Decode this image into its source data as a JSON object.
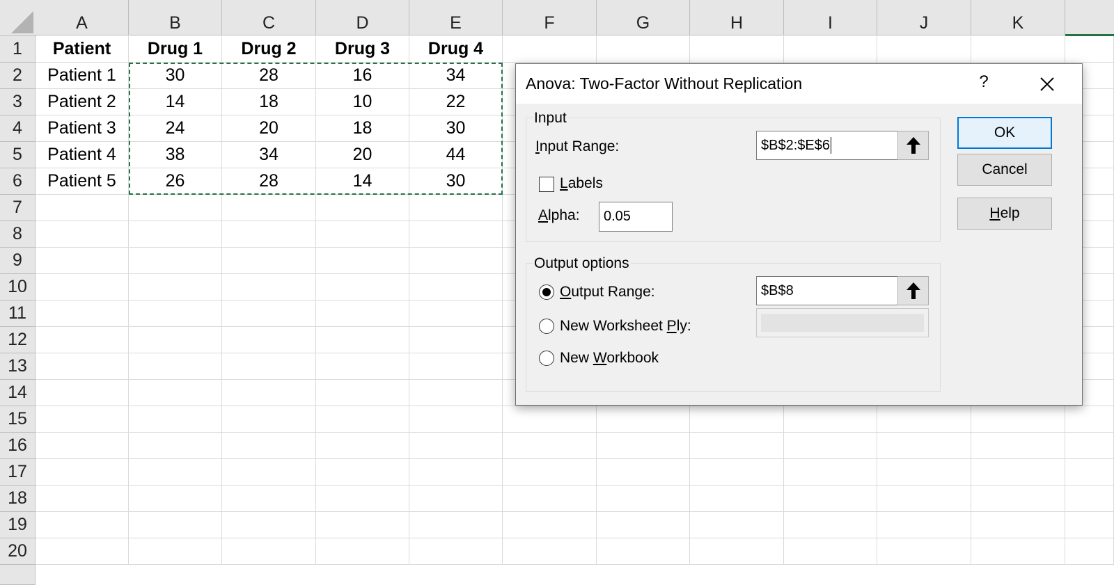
{
  "sheet": {
    "columns": [
      "A",
      "B",
      "C",
      "D",
      "E",
      "F",
      "G",
      "H",
      "I",
      "J",
      "K"
    ],
    "rows": [
      "1",
      "2",
      "3",
      "4",
      "5",
      "6",
      "7",
      "8",
      "9",
      "10",
      "11",
      "12",
      "13",
      "14",
      "15",
      "16",
      "17",
      "18",
      "19",
      "20"
    ],
    "cells": [
      [
        "Patient",
        "Drug 1",
        "Drug 2",
        "Drug 3",
        "Drug 4"
      ],
      [
        "Patient 1",
        "30",
        "28",
        "16",
        "34"
      ],
      [
        "Patient 2",
        "14",
        "18",
        "10",
        "22"
      ],
      [
        "Patient 3",
        "24",
        "20",
        "18",
        "30"
      ],
      [
        "Patient 4",
        "38",
        "34",
        "20",
        "44"
      ],
      [
        "Patient 5",
        "26",
        "28",
        "14",
        "30"
      ]
    ],
    "selection_range": "$B$2:$E$6",
    "selection_color": "#217346"
  },
  "dialog": {
    "title": "Anova: Two-Factor Without Replication",
    "help_glyph": "?",
    "input_group": {
      "label": "Input",
      "input_range_label_pre": "",
      "input_range_label_u": "I",
      "input_range_label_post": "nput Range:",
      "input_range_value": "$B$2:$E$6",
      "labels_checkbox_u": "L",
      "labels_checkbox_post": "abels",
      "labels_checked": false,
      "alpha_label_u": "A",
      "alpha_label_post": "lpha:",
      "alpha_value": "0.05"
    },
    "output_group": {
      "label": "Output options",
      "output_range_u": "O",
      "output_range_post": "utput Range:",
      "output_range_value": "$B$8",
      "new_ply_pre": "New Worksheet ",
      "new_ply_u": "P",
      "new_ply_post": "ly:",
      "new_workbook_pre": "New ",
      "new_workbook_u": "W",
      "new_workbook_post": "orkbook",
      "selected_option": "Output Range"
    },
    "buttons": {
      "ok": "OK",
      "cancel": "Cancel",
      "help_u": "H",
      "help_post": "elp"
    },
    "accent_color": "#0078d7"
  }
}
